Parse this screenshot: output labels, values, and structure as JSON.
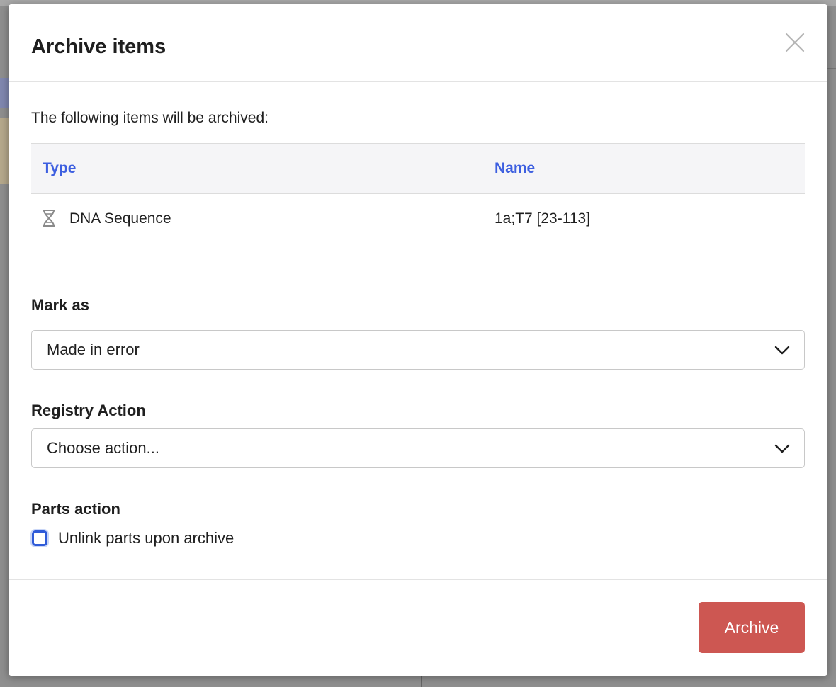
{
  "modal": {
    "title": "Archive items",
    "intro": "The following items will be archived:"
  },
  "table": {
    "columns": [
      "Type",
      "Name"
    ],
    "rows": [
      {
        "type": "DNA Sequence",
        "name": "1a;T7 [23-113]",
        "icon": "dna-icon"
      }
    ]
  },
  "mark_as": {
    "label": "Mark as",
    "selected": "Made in error"
  },
  "registry_action": {
    "label": "Registry Action",
    "selected": "Choose action..."
  },
  "parts_action": {
    "label": "Parts action",
    "checkbox_label": "Unlink parts upon archive",
    "checked": false
  },
  "footer": {
    "archive_label": "Archive"
  },
  "colors": {
    "header_link": "#3d5fe0",
    "archive_button": "#cd5752",
    "checkbox_focus": "#2f5bd8"
  }
}
